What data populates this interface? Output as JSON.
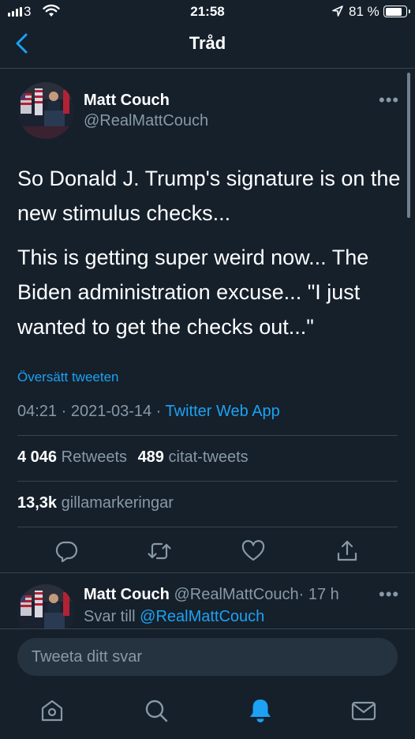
{
  "status_bar": {
    "carrier": "3",
    "time": "21:58",
    "battery_percent": "81 %",
    "battery_level": 0.81
  },
  "nav": {
    "title": "Tråd"
  },
  "tweet": {
    "author_name": "Matt Couch",
    "author_handle": "@RealMattCouch",
    "paragraphs": [
      "So Donald J. Trump's signature is on the new stimulus checks...",
      "This is getting super weird now... The Biden administration excuse... \"I just wanted to get the checks out...\""
    ],
    "translate_label": "Översätt tweeten",
    "timestamp": "04:21 · 2021-03-14 ·",
    "source": "Twitter Web App",
    "retweets_count": "4 046",
    "retweets_label": "Retweets",
    "quotes_count": "489",
    "quotes_label": "citat-tweets",
    "likes_count": "13,3k",
    "likes_label": "gillamarkeringar"
  },
  "reply": {
    "author_name": "Matt Couch",
    "author_handle": "@RealMattCouch",
    "age": "· 17 h",
    "replying_prefix": "Svar till",
    "replying_to": "@RealMattCouch"
  },
  "composer": {
    "placeholder": "Tweeta ditt svar"
  },
  "colors": {
    "background": "#15202b",
    "accent": "#1da1f2",
    "muted": "#8899a6",
    "divider": "#38444d"
  },
  "icons": {
    "reply": "speech-bubble-icon",
    "retweet": "retweet-icon",
    "like": "heart-icon",
    "share": "share-icon",
    "home": "home-icon",
    "search": "search-icon",
    "notifications": "bell-icon",
    "messages": "envelope-icon"
  }
}
